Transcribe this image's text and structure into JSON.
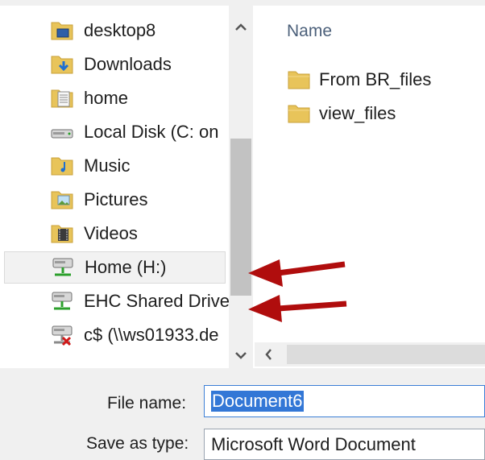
{
  "nav": {
    "items": [
      {
        "label": "desktop8",
        "icon": "desktop-folder-icon"
      },
      {
        "label": "Downloads",
        "icon": "downloads-folder-icon"
      },
      {
        "label": "home",
        "icon": "document-folder-icon"
      },
      {
        "label": "Local Disk (C: on",
        "icon": "local-disk-icon"
      },
      {
        "label": "Music",
        "icon": "music-folder-icon"
      },
      {
        "label": "Pictures",
        "icon": "pictures-folder-icon"
      },
      {
        "label": "Videos",
        "icon": "videos-folder-icon"
      },
      {
        "label": "Home (H:)",
        "icon": "network-drive-icon",
        "selected": true
      },
      {
        "label": "EHC Shared Drive",
        "icon": "network-drive-icon"
      },
      {
        "label": "c$ (\\\\ws01933.de",
        "icon": "disconnected-network-drive-icon"
      }
    ]
  },
  "files": {
    "column_header": "Name",
    "items": [
      {
        "label": "From BR_files",
        "icon": "folder-icon"
      },
      {
        "label": "view_files",
        "icon": "folder-icon"
      }
    ]
  },
  "form": {
    "file_name_label": "File name:",
    "file_name_value": "Document6",
    "save_as_type_label": "Save as type:",
    "save_as_type_value": "Microsoft Word Document"
  },
  "colors": {
    "annotation_arrow": "#b00d0d",
    "selection": "#3377d6",
    "folder": "#e8c45a"
  }
}
